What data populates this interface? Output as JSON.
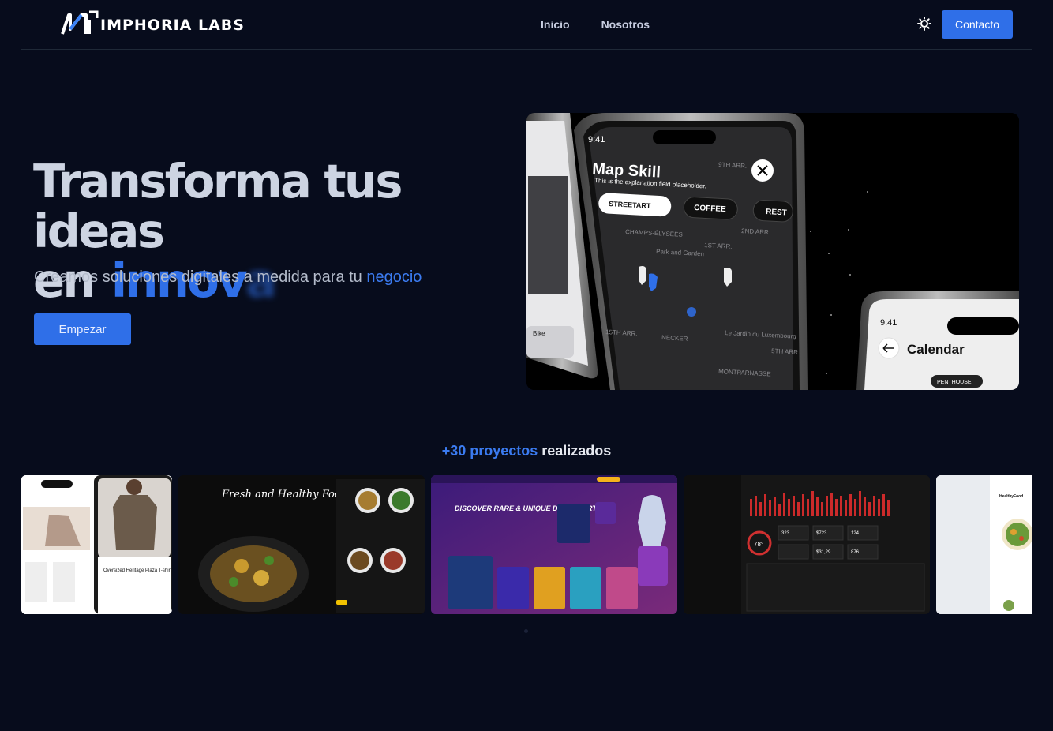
{
  "brand": {
    "name": "IMPHORIA LABS",
    "icon": "imphoria-logo-icon"
  },
  "nav": {
    "items": [
      {
        "label": "Inicio"
      },
      {
        "label": "Nosotros"
      }
    ]
  },
  "header": {
    "theme_icon": "sun-icon",
    "contact_label": "Contacto"
  },
  "hero": {
    "title_line1": "Transforma tus ideas",
    "title_line2_prefix": "en",
    "typing_visible": "innov",
    "typing_fading": "a",
    "subtitle_text": "Creamos soluciones digitales a medida para tu",
    "subtitle_accent": "negocio",
    "cta_label": "Empezar",
    "image": {
      "time": "9:41",
      "app_title": "Map Skill",
      "app_subtitle": "This is the explanation field placeholder.",
      "chips": [
        "STREETART",
        "COFFEE",
        "REST"
      ],
      "second_time": "9:41",
      "second_title": "Calendar",
      "second_chip": "PENTHOUSE",
      "map_labels": [
        "CHAMPS-ÉLYSÉES",
        "1ST ARR.",
        "2ND ARR.",
        "9TH ARR.",
        "5TH ARR.",
        "15TH ARR.",
        "NECKER",
        "MONTPARNASSE",
        "Le Jardin du Luxembourg",
        "Park and Garden"
      ]
    }
  },
  "projects": {
    "count_accent": "+30 proyectos",
    "count_suffix": "realizados",
    "cards": [
      {
        "name": "fashion-app",
        "caption": "Oversized Heritage Plaza T-shirt"
      },
      {
        "name": "food-app",
        "title": "Fresh and Healthy Food Specialties"
      },
      {
        "name": "nft-marketplace",
        "title": "DISCOVER RARE & UNIQUE DIGITAL ART"
      },
      {
        "name": "analytics-dashboard",
        "stats": [
          "323",
          "$723",
          "124",
          "$31,29",
          "876",
          "78°"
        ]
      },
      {
        "name": "healthy-food-app",
        "title": "HealthyFood"
      }
    ]
  },
  "colors": {
    "background": "#070c1c",
    "accent": "#2f6fe8",
    "text": "#cdd4e2"
  }
}
